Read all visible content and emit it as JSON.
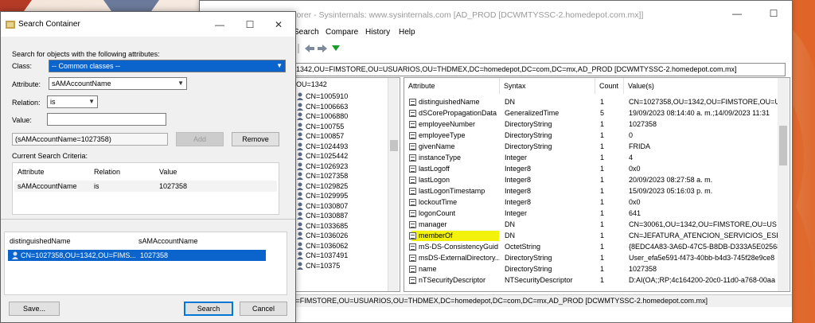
{
  "main_window": {
    "title": "rorer - Sysinternals: www.sysinternals.com [AD_PROD [DCWMTYSSC-2.homedepot.com.mx]]",
    "controls": {
      "minimize": "—",
      "maximize": "☐"
    },
    "menu": [
      "Search",
      "Compare",
      "History",
      "Help"
    ],
    "path": "1342,OU=FIMSTORE,OU=USUARIOS,OU=THDMEX,DC=homedepot,DC=com,DC=mx,AD_PROD [DCWMTYSSC-2.homedepot.com.mx]",
    "tree": {
      "header": "OU=1342",
      "items": [
        "CN=1005910",
        "CN=1006663",
        "CN=1006880",
        "CN=100755",
        "CN=100857",
        "CN=1024493",
        "CN=1025442",
        "CN=1026923",
        "CN=1027358",
        "CN=1029825",
        "CN=1029995",
        "CN=1030807",
        "CN=1030887",
        "CN=1033685",
        "CN=1036026",
        "CN=1036062",
        "CN=1037491",
        "CN=10375"
      ]
    },
    "attributes": {
      "columns": [
        "Attribute",
        "Syntax",
        "Count",
        "Value(s)"
      ],
      "rows": [
        [
          "distinguishedName",
          "DN",
          "1",
          "CN=1027358,OU=1342,OU=FIMSTORE,OU=U"
        ],
        [
          "dSCorePropagationData",
          "GeneralizedTime",
          "5",
          "19/09/2023 08:14:40 a. m.;14/09/2023 11:31"
        ],
        [
          "employeeNumber",
          "DirectoryString",
          "1",
          "1027358"
        ],
        [
          "employeeType",
          "DirectoryString",
          "1",
          "0"
        ],
        [
          "givenName",
          "DirectoryString",
          "1",
          "FRIDA"
        ],
        [
          "instanceType",
          "Integer",
          "1",
          "4"
        ],
        [
          "lastLogoff",
          "Integer8",
          "1",
          "0x0"
        ],
        [
          "lastLogon",
          "Integer8",
          "1",
          "20/09/2023 08:27:58 a. m."
        ],
        [
          "lastLogonTimestamp",
          "Integer8",
          "1",
          "15/09/2023 05:16:03 p. m."
        ],
        [
          "lockoutTime",
          "Integer8",
          "1",
          "0x0"
        ],
        [
          "logonCount",
          "Integer",
          "1",
          "641"
        ],
        [
          "manager",
          "DN",
          "1",
          "CN=30061,OU=1342,OU=FIMSTORE,OU=US"
        ],
        [
          "memberOf",
          "DN",
          "1",
          "CN=JEFATURA_ATENCION_SERVICIOS_ESPE"
        ],
        [
          "mS-DS-ConsistencyGuid",
          "OctetString",
          "1",
          "{8EDC4A83-3A6D-47C5-B8DB-D333A5E02568"
        ],
        [
          "msDS-ExternalDirectory...",
          "DirectoryString",
          "1",
          "User_efa5e591-f473-40bb-b4d3-745f28e9ce8"
        ],
        [
          "name",
          "DirectoryString",
          "1",
          "1027358"
        ],
        [
          "nTSecurityDescriptor",
          "NTSecurityDescriptor",
          "1",
          "D:AI(OA;;RP;4c164200-20c0-11d0-a768-00aa"
        ]
      ]
    },
    "status": "U=FIMSTORE,OU=USUARIOS,OU=THDMEX,DC=homedepot,DC=com,DC=mx,AD_PROD [DCWMTYSSC-2.homedepot.com.mx]"
  },
  "dialog": {
    "title": "Search Container",
    "controls": {
      "minimize": "—",
      "maximize": "☐",
      "close": "✕"
    },
    "instructions": "Search for objects with the following attributes:",
    "class_label": "Class:",
    "class_value": "-- Common classes --",
    "attribute_label": "Attribute:",
    "attribute_value": "sAMAccountName",
    "relation_label": "Relation:",
    "relation_value": "is",
    "value_label": "Value:",
    "value_input": "",
    "criteria_text": "(sAMAccountName=1027358)",
    "add_label": "Add",
    "remove_label": "Remove",
    "current_criteria_label": "Current Search Criteria:",
    "criteria_columns": [
      "Attribute",
      "Relation",
      "Value"
    ],
    "criteria_row": [
      "sAMAccountName",
      "is",
      "1027358"
    ],
    "results_columns": [
      "distinguishedName",
      "sAMAccountName"
    ],
    "results_row": [
      "CN=1027358,OU=1342,OU=FIMS...",
      "1027358"
    ],
    "save_label": "Save...",
    "search_label": "Search",
    "cancel_label": "Cancel"
  },
  "colors": {
    "selection": "#0a64cc",
    "highlight": "#f2f20a",
    "accent": "#0078d7"
  }
}
